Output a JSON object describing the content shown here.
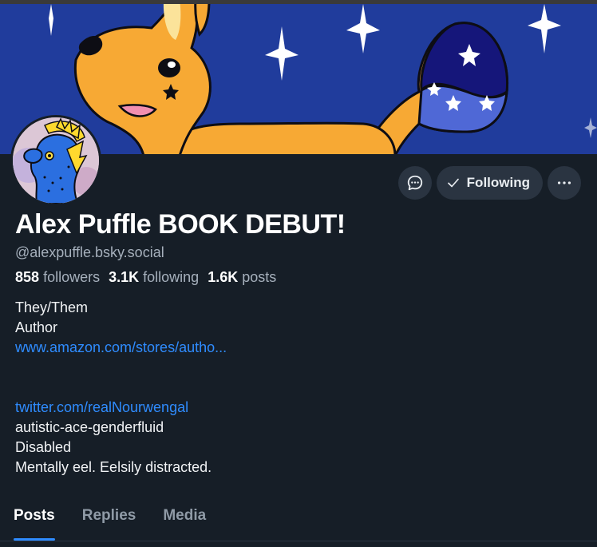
{
  "profile": {
    "display_name": "Alex Puffle BOOK DEBUT!",
    "handle": "@alexpuffle.bsky.social",
    "stats": {
      "followers_count": "858",
      "followers_label": "followers",
      "following_count": "3.1K",
      "following_label": "following",
      "posts_count": "1.6K",
      "posts_label": "posts"
    },
    "bio": {
      "line1": "They/Them",
      "line2": "Author",
      "link1": "www.amazon.com/stores/autho...",
      "link2": "twitter.com/realNourwengal",
      "line3": "autistic-ace-genderfluid",
      "line4": "Disabled",
      "line5": "Mentally eel. Eelsily distracted."
    }
  },
  "actions": {
    "message_icon": "chat-bubble-icon",
    "follow_label": "Following",
    "follow_icon": "checkmark-icon",
    "more_icon": "ellipsis-icon"
  },
  "tabs": [
    {
      "label": "Posts",
      "active": true
    },
    {
      "label": "Replies",
      "active": false
    },
    {
      "label": "Media",
      "active": false
    }
  ],
  "colors": {
    "background": "#161e27",
    "accent": "#2f8cff",
    "banner_sky": "#203c9c",
    "fox_orange": "#f7a934"
  }
}
